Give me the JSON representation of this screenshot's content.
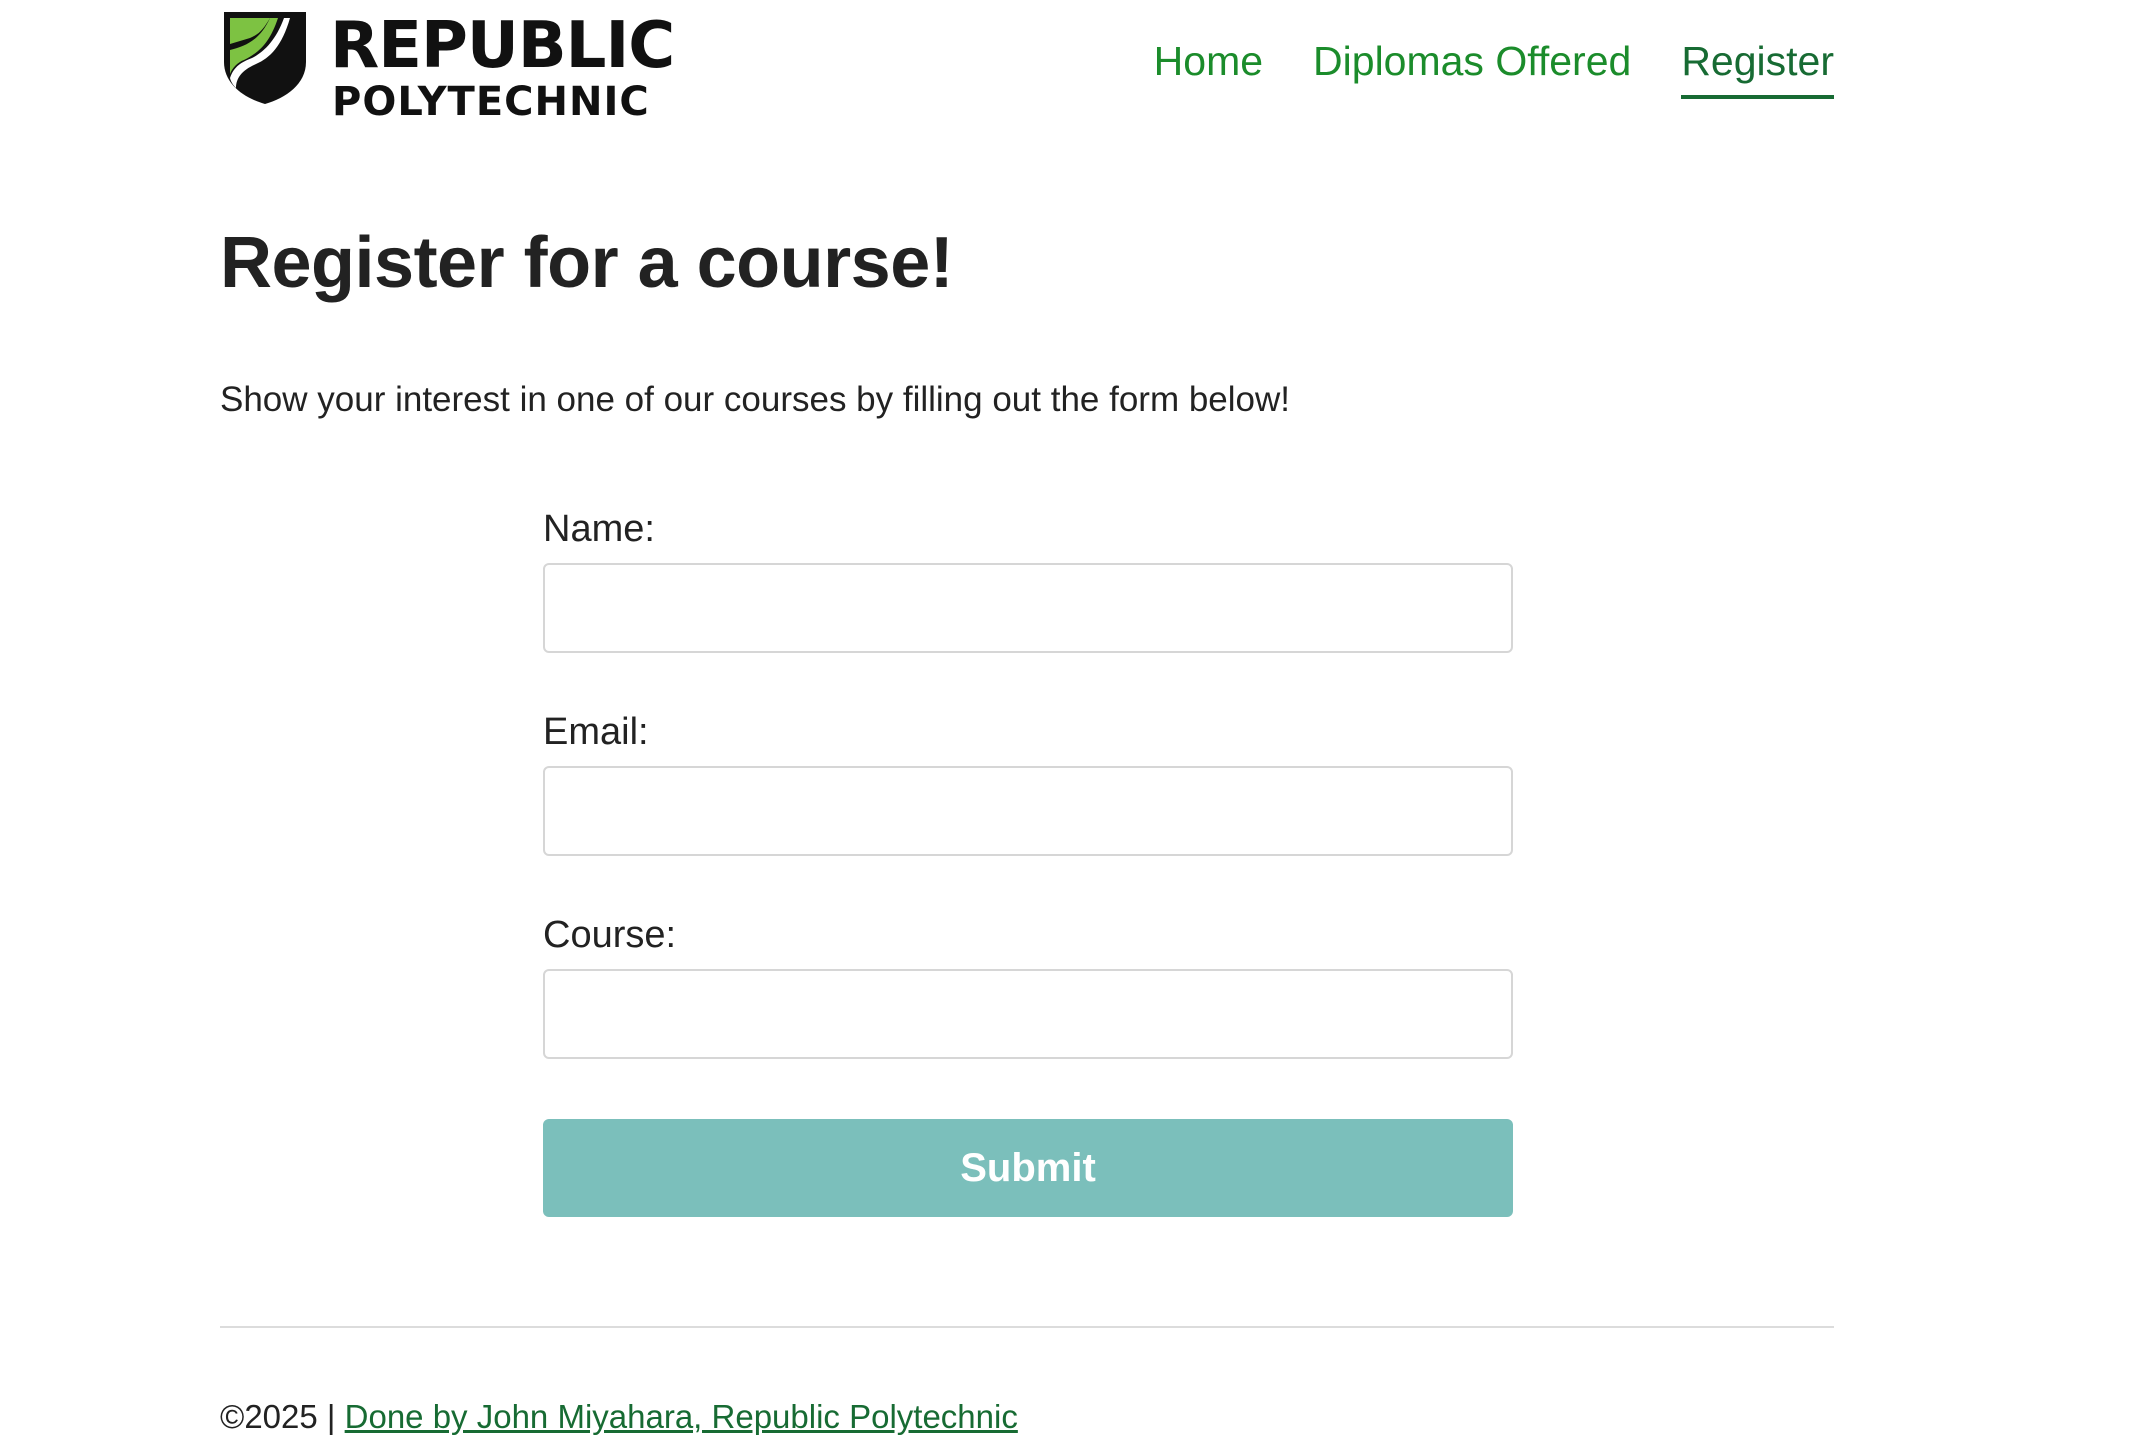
{
  "header": {
    "logo_line1": "REPUBLIC",
    "logo_line2": "POLYTECHNIC",
    "nav": [
      {
        "label": "Home",
        "active": false
      },
      {
        "label": "Diplomas Offered",
        "active": false
      },
      {
        "label": "Register",
        "active": true
      }
    ]
  },
  "main": {
    "title": "Register for a course!",
    "intro": "Show your interest in one of our courses by filling out the form below!",
    "form": {
      "name_label": "Name:",
      "name_value": "",
      "email_label": "Email:",
      "email_value": "",
      "course_label": "Course:",
      "course_value": "",
      "submit_label": "Submit"
    }
  },
  "footer": {
    "copyright": "©2025 | ",
    "link_text": "Done by John Miyahara, Republic Polytechnic"
  },
  "colors": {
    "nav_link": "#1b8c2b",
    "nav_active": "#176b33",
    "submit_bg": "#7bbfbb",
    "logo_green": "#7dc242"
  },
  "icons": {
    "logo": "shield-logo-icon"
  }
}
